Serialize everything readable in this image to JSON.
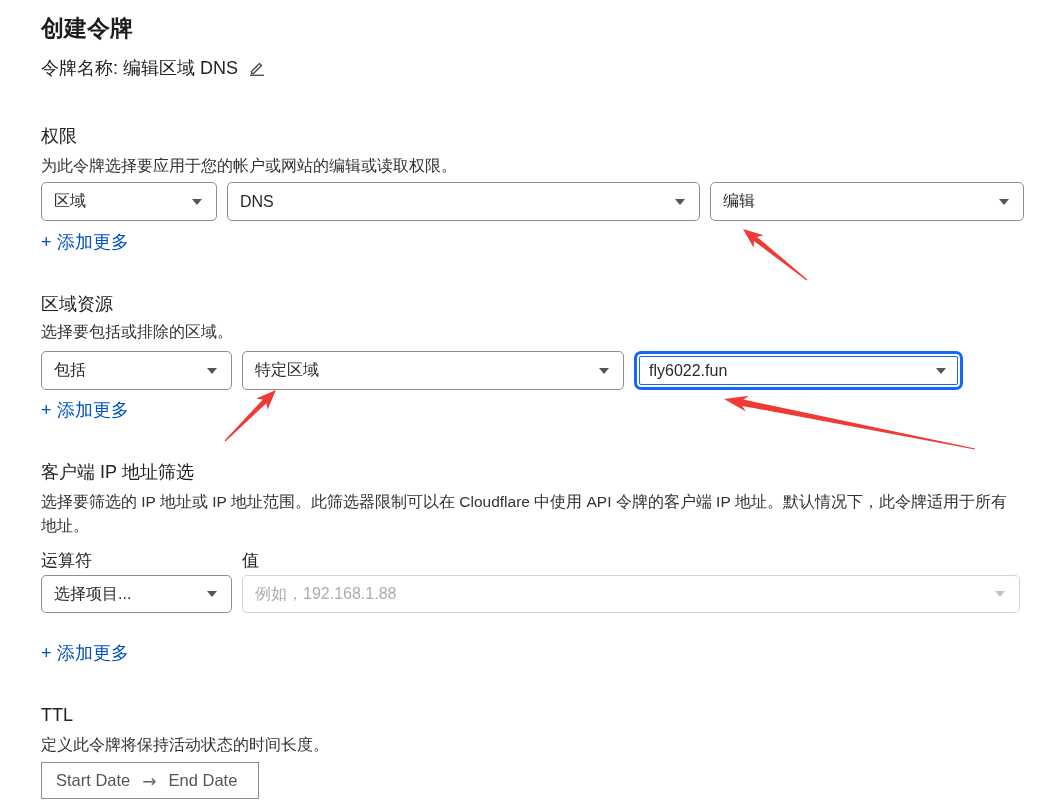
{
  "page": {
    "title": "创建令牌",
    "token_name": "令牌名称: 编辑区域 DNS"
  },
  "sections": [
    {
      "kind": "selects",
      "title": "权限",
      "description": "为此令牌选择要应用于您的帐户或网站的编辑或读取权限。",
      "selects": [
        {
          "value": "区域",
          "focused": false
        },
        {
          "value": "DNS",
          "focused": false
        },
        {
          "value": "编辑",
          "focused": false
        }
      ],
      "add_more": "+ 添加更多"
    },
    {
      "kind": "selects",
      "title": "区域资源",
      "description": "选择要包括或排除的区域。",
      "selects": [
        {
          "value": "包括",
          "focused": false
        },
        {
          "value": "特定区域",
          "focused": false
        },
        {
          "value": "fly6022.fun",
          "focused": true
        }
      ],
      "add_more": "+ 添加更多"
    },
    {
      "kind": "filter",
      "title": "客户端 IP 地址筛选",
      "description": "选择要筛选的 IP 地址或 IP 地址范围。此筛选器限制可以在 Cloudflare 中使用 API 令牌的客户端 IP 地址。默认情况下，此令牌适用于所有地址。",
      "fields": [
        {
          "label": "运算符",
          "value": "选择项目...",
          "disabled": false
        },
        {
          "label": "值",
          "placeholder": "例如，192.168.1.88",
          "disabled": true
        }
      ],
      "add_more": "+ 添加更多"
    },
    {
      "kind": "daterange",
      "title": "TTL",
      "description": "定义此令牌将保持活动状态的时间长度。",
      "date_range": {
        "start": "Start Date",
        "separator": "→",
        "end": "End Date"
      }
    }
  ]
}
